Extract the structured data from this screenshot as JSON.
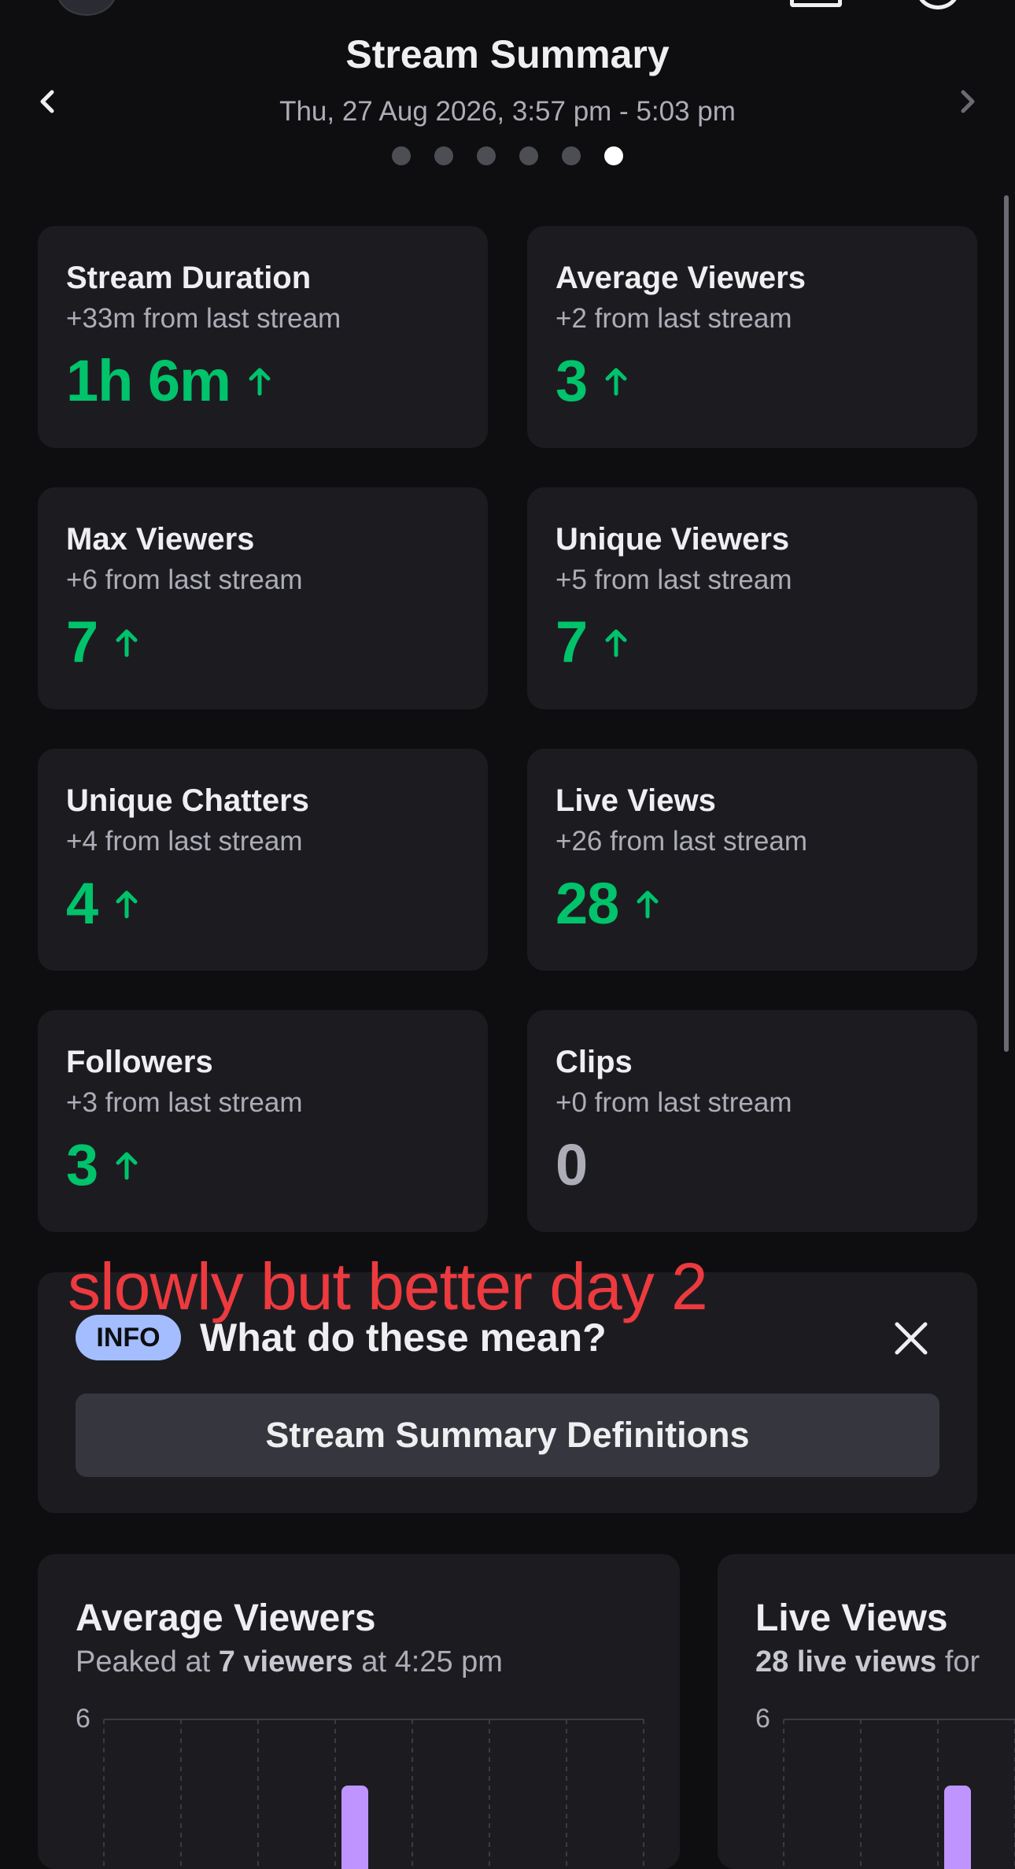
{
  "header": {
    "title": "Stream Summary",
    "date_range": "Thu, 27 Aug 2026, 3:57 pm - 5:03 pm",
    "page_dots": 6,
    "active_dot": 5
  },
  "cards": [
    {
      "title": "Stream Duration",
      "delta": "+33m from last stream",
      "value": "1h 6m",
      "trend": "up"
    },
    {
      "title": "Average Viewers",
      "delta": "+2 from last stream",
      "value": "3",
      "trend": "up"
    },
    {
      "title": "Max Viewers",
      "delta": "+6 from last stream",
      "value": "7",
      "trend": "up"
    },
    {
      "title": "Unique Viewers",
      "delta": "+5 from last stream",
      "value": "7",
      "trend": "up"
    },
    {
      "title": "Unique Chatters",
      "delta": "+4 from last stream",
      "value": "4",
      "trend": "up"
    },
    {
      "title": "Live Views",
      "delta": "+26 from last stream",
      "value": "28",
      "trend": "up"
    },
    {
      "title": "Followers",
      "delta": "+3 from last stream",
      "value": "3",
      "trend": "up"
    },
    {
      "title": "Clips",
      "delta": "+0 from last stream",
      "value": "0",
      "trend": "none"
    }
  ],
  "annotation": "slowly but better day 2",
  "info": {
    "badge": "INFO",
    "question": "What do these mean?",
    "button_label": "Stream Summary Definitions"
  },
  "charts": [
    {
      "title": "Average Viewers",
      "sub_prefix": "Peaked at ",
      "sub_bold": "7 viewers",
      "sub_suffix": " at 4:25 pm",
      "y_tick": "6"
    },
    {
      "title": "Live Views",
      "sub_prefix": "",
      "sub_bold": "28 live views",
      "sub_suffix": " for",
      "y_tick": "6"
    }
  ],
  "colors": {
    "accent_green": "#00c36b",
    "badge_blue": "#a3bdff",
    "annotation_red": "#ec3a3f",
    "bar_purple": "#bf94ff"
  }
}
